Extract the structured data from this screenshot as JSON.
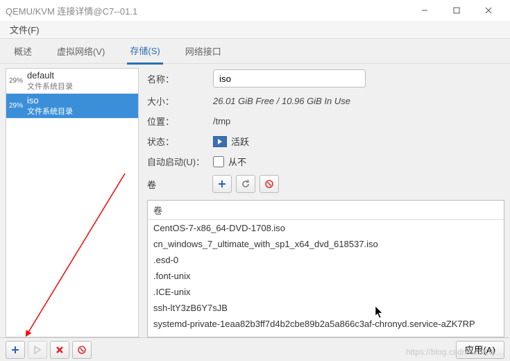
{
  "window": {
    "title": "QEMU/KVM 连接详情@C7--01.1"
  },
  "menubar": {
    "file": "文件(F)"
  },
  "tabs": {
    "overview": "概述",
    "virtual_net": "虚拟网络(V)",
    "storage": "存储(S)",
    "net_if": "网络接口"
  },
  "sidebar": {
    "items": [
      {
        "pct": "29%",
        "name": "default",
        "sub": "文件系统目录"
      },
      {
        "pct": "29%",
        "name": "iso",
        "sub": "文件系统目录"
      }
    ]
  },
  "form": {
    "name_label": "名称：",
    "name_value": "iso",
    "size_label": "大小：",
    "size_value": "26.01 GiB Free / 10.96 GiB In Use",
    "location_label": "位置：",
    "location_value": "/tmp",
    "state_label": "状态：",
    "state_value": "活跃",
    "autostart_label": "自动启动(U)：",
    "autostart_text": "从不",
    "volumes_label": "卷"
  },
  "vol_list": {
    "header": "卷",
    "rows": [
      "CentOS-7-x86_64-DVD-1708.iso",
      "cn_windows_7_ultimate_with_sp1_x64_dvd_618537.iso",
      ".esd-0",
      ".font-unix",
      ".ICE-unix",
      "ssh-ltY3zB6Y7sJB",
      "systemd-private-1eaa82b3ff7d4b2cbe89b2a5a866c3af-chronyd.service-aZK7RP"
    ]
  },
  "buttons": {
    "apply": "应用(A)"
  },
  "watermark": "https://blog.csdn.net/KW…"
}
